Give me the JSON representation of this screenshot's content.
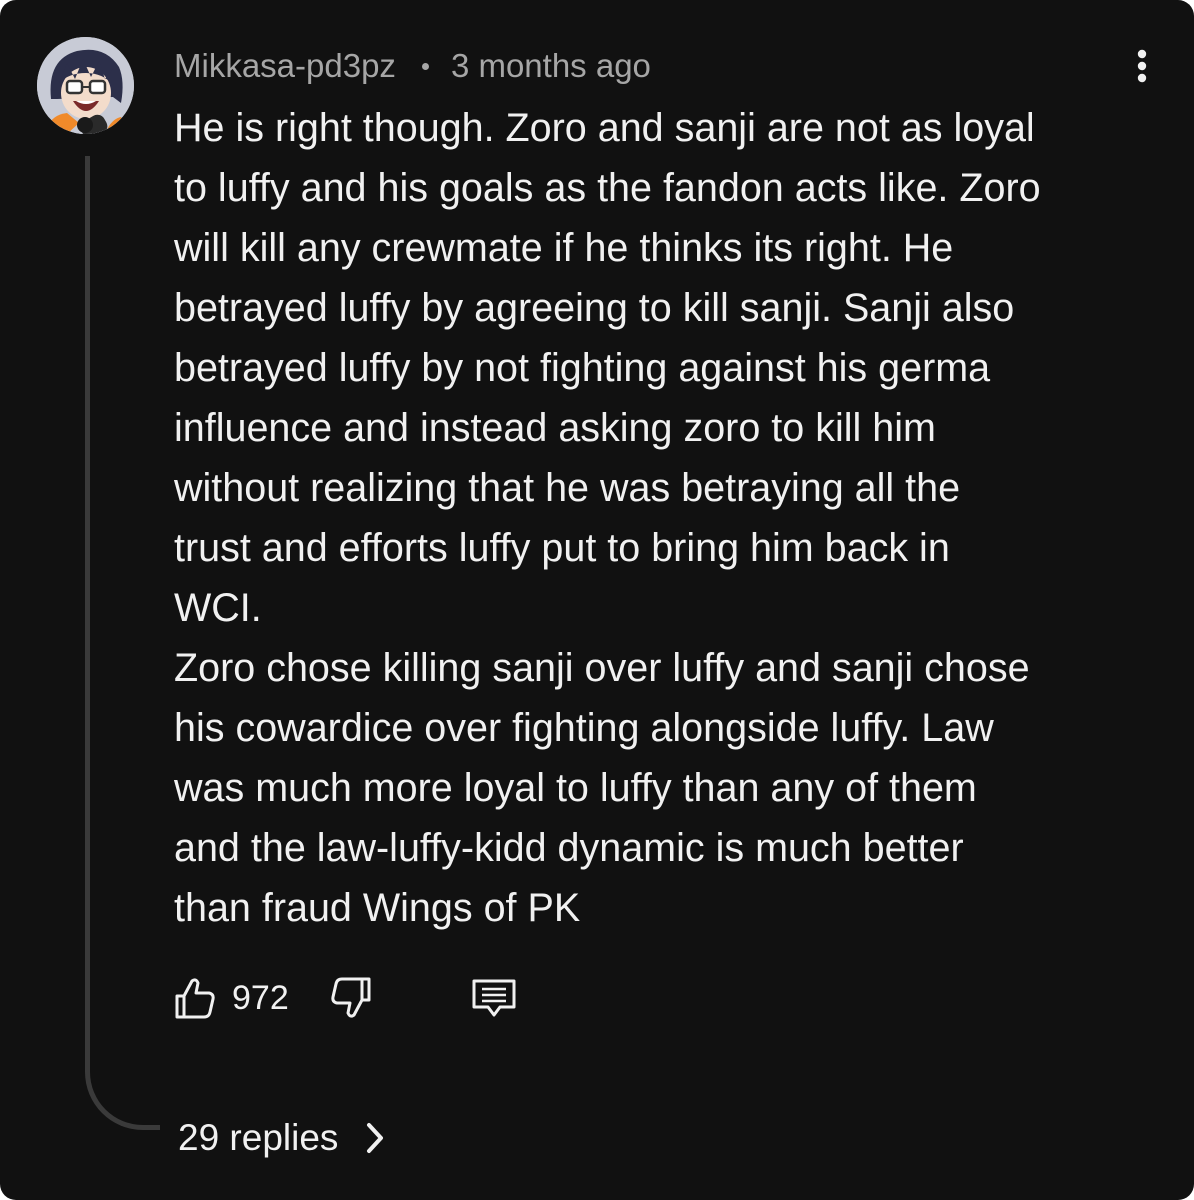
{
  "comment": {
    "author": "Mikkasa-pd3pz",
    "timestamp": "3 months ago",
    "text_lines": [
      "He is right though. Zoro and sanji are not as loyal",
      "to luffy and his goals as the fandon acts like. Zoro",
      "will kill any crewmate if he thinks its right. He",
      "betrayed luffy by agreeing to kill sanji. Sanji also",
      "betrayed luffy by not fighting against his germa",
      "influence and instead asking zoro to kill him",
      "without realizing that he was betraying all the",
      "trust and efforts luffy put to bring him back in",
      "WCI.",
      "Zoro chose killing sanji over luffy and sanji chose",
      "his cowardice over fighting alongside luffy. Law",
      "was much more loyal to luffy than any of them",
      "and the law-luffy-kidd dynamic is much better",
      "than fraud Wings of PK"
    ],
    "like_count": "972",
    "replies_label": "29 replies"
  },
  "icons": {
    "avatar": "avatar-anime-character",
    "menu": "more-vertical-icon",
    "like": "thumbs-up-icon",
    "dislike": "thumbs-down-icon",
    "reply": "reply-comment-icon",
    "chevron": "chevron-right-icon"
  },
  "colors": {
    "background": "#111111",
    "text_primary": "#f1f1f1",
    "text_secondary": "#a6a6a6",
    "thread_line": "#3a3a3a"
  }
}
